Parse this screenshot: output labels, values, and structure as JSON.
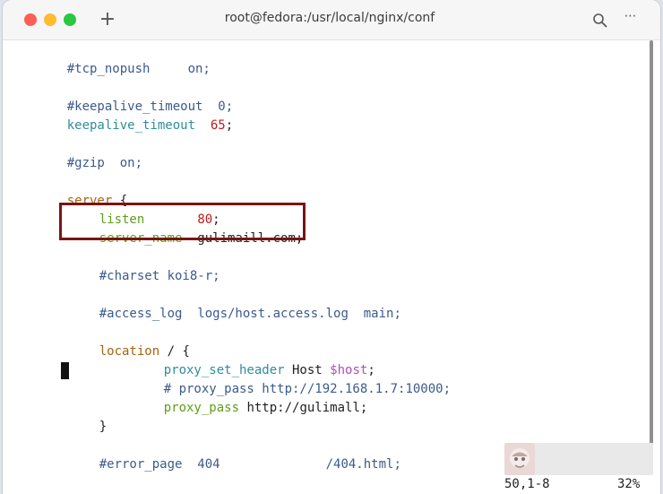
{
  "window": {
    "title": "root@fedora:/usr/local/nginx/conf"
  },
  "titlebar": {
    "new_tab_label": "+",
    "more_label": "⋯"
  },
  "editor": {
    "lines": [
      {
        "t1": "#tcp_nopush     on;"
      },
      {
        "t1": "#keepalive_timeout  0;"
      },
      {
        "kw": "keepalive_timeout",
        "sp": "  ",
        "num": "65",
        "end": ";"
      },
      {
        "t1": "#gzip  on;"
      },
      {
        "blk": "server",
        "rest": " {"
      },
      {
        "dir": "listen",
        "sp": "       ",
        "num": "80",
        "end": ";"
      },
      {
        "dir": "server_name",
        "rest": "  gulimaill.com;"
      },
      {
        "t1": "#charset koi8-r;"
      },
      {
        "t1": "#access_log  logs/host.access.log  main;"
      },
      {
        "blk": "location",
        "rest": " / {"
      },
      {
        "kw": "proxy_set_header",
        "mid": " Host ",
        "var": "$host",
        "end": ";"
      },
      {
        "t1": "# proxy_pass http://192.168.1.7:10000;"
      },
      {
        "dir": "proxy_pass",
        "rest": " http://gulimall;"
      },
      {
        "rest": "}"
      },
      {
        "t1": "#error_page  404              /404.html;"
      }
    ]
  },
  "status": {
    "position": "50,1-8",
    "percent": "32%"
  },
  "colors": {
    "comment": "#3c5a8c",
    "keyword": "#2f8d9a",
    "number": "#c01a1a",
    "block": "#a56312",
    "directive": "#5f9e1a",
    "variable": "#b04dbb",
    "highlight_border": "#7b1414"
  },
  "icons": {
    "search": "search-icon",
    "more": "more-options-icon",
    "new_tab": "plus-icon"
  }
}
